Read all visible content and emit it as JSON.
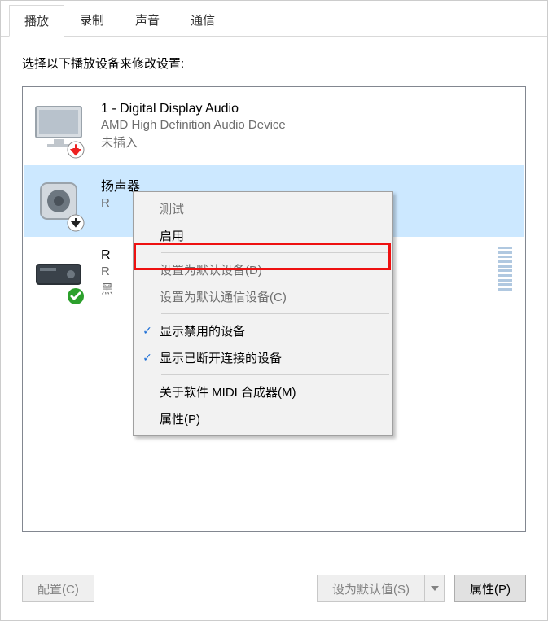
{
  "tabs": {
    "playback": "播放",
    "recording": "录制",
    "sounds": "声音",
    "communications": "通信"
  },
  "instruction": "选择以下播放设备来修改设置:",
  "devices": [
    {
      "name": "1 - Digital Display Audio",
      "desc": "AMD High Definition Audio Device",
      "status": "未插入"
    },
    {
      "name": "扬声器",
      "desc": "R",
      "status": ""
    },
    {
      "name": "R",
      "desc": "R",
      "status": "黑"
    }
  ],
  "context_menu": {
    "test": "测试",
    "enable": "启用",
    "set_default": "设置为默认设备(D)",
    "set_default_comm": "设置为默认通信设备(C)",
    "show_disabled": "显示禁用的设备",
    "show_disconnected": "显示已断开连接的设备",
    "about_midi": "关于软件 MIDI 合成器(M)",
    "properties": "属性(P)"
  },
  "buttons": {
    "configure": "配置(C)",
    "set_default": "设为默认值(S)",
    "properties": "属性(P)"
  }
}
